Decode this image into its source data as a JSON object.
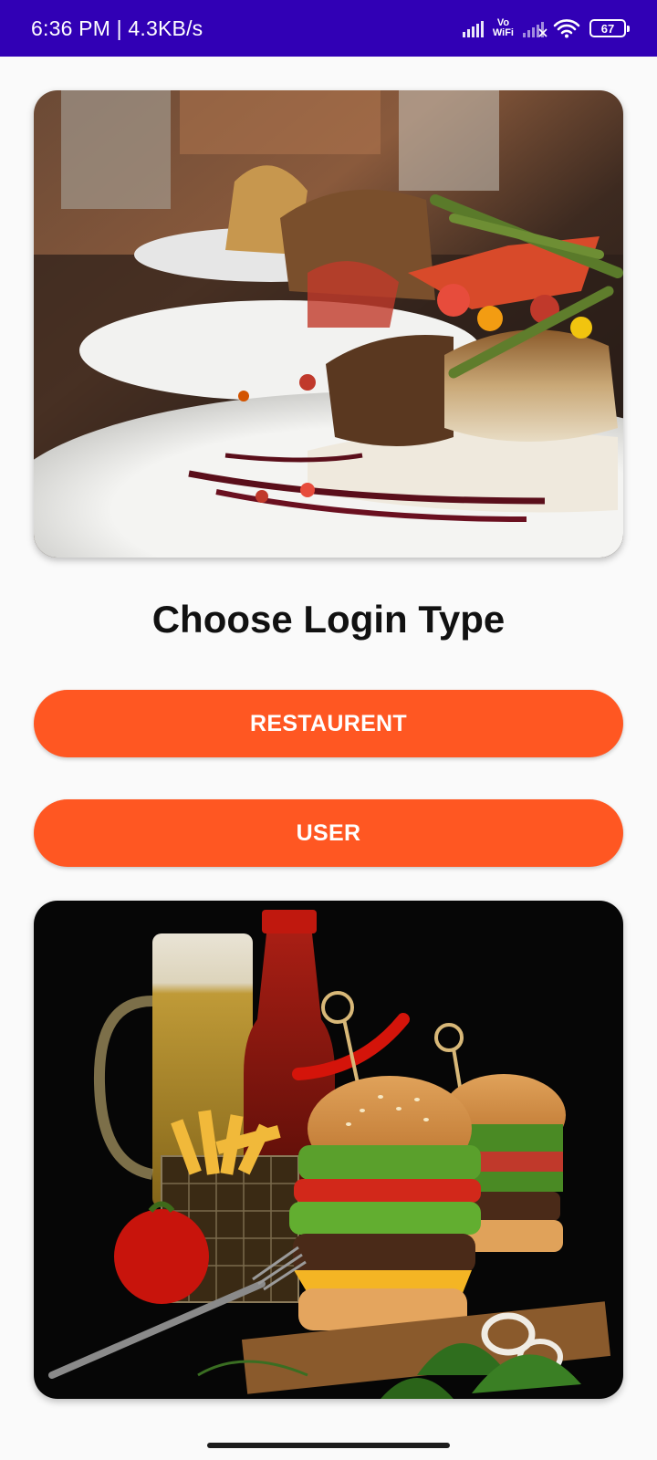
{
  "status_bar": {
    "time": "6:36 PM",
    "separator": " | ",
    "network_speed": "4.3KB/s",
    "vowifi_top": "Vo",
    "vowifi_bottom": "WiFi",
    "battery_level": "67",
    "icons": [
      "signal-icon",
      "vowifi-icon",
      "signal-no-service-icon",
      "wifi-icon",
      "battery-icon"
    ]
  },
  "images": {
    "top": "plated-fish-dish-photo",
    "bottom": "burgers-fries-beer-photo"
  },
  "main": {
    "title": "Choose Login Type",
    "buttons": {
      "restaurant_label": "RESTAURENT",
      "user_label": "USER"
    }
  },
  "colors": {
    "status_bar": "#3100b5",
    "accent": "#ff5722",
    "background": "#fafafa",
    "title_text": "#111111"
  }
}
